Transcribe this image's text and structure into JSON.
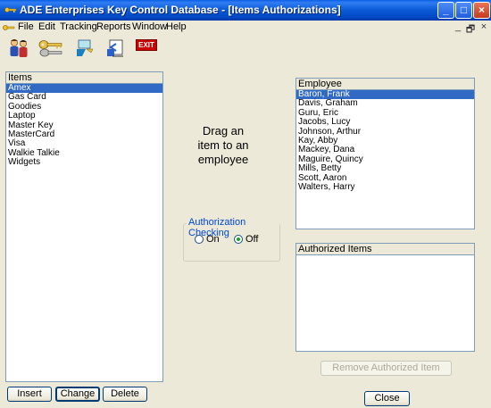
{
  "window": {
    "title": "ADE Enterprises Key Control Database - [Items Authorizations]",
    "buttons": {
      "minimize": "_",
      "maximize": "□",
      "close": "×"
    }
  },
  "menu": {
    "items": [
      "File",
      "Edit",
      "Tracking",
      "Reports",
      "Window",
      "Help"
    ],
    "mdi_controls": {
      "minimize": "_",
      "restore": "🗗",
      "close": "×"
    }
  },
  "toolbar": {
    "icons": [
      "people-icon",
      "keys-icon",
      "tracking-icon",
      "report-icon",
      "exit-icon"
    ],
    "exit_label": "EXIT"
  },
  "items_panel": {
    "header": "Items",
    "items": [
      "Amex",
      "Gas Card",
      "Goodies",
      "Laptop",
      "Master Key",
      "MasterCard",
      "Visa",
      "Walkie Talkie",
      "Widgets"
    ],
    "selected_index": 0
  },
  "instruction": {
    "line1": "Drag an",
    "line2": "item to an",
    "line3": "employee"
  },
  "authorization_checking": {
    "label": "Authorization Checking",
    "options": [
      "On",
      "Off"
    ],
    "selected": "Off"
  },
  "employee_panel": {
    "header": "Employee",
    "items": [
      "Baron, Frank",
      "Davis, Graham",
      "Guru, Eric",
      "Jacobs, Lucy",
      "Johnson, Arthur",
      "Kay, Abby",
      "Mackey, Dana",
      "Maguire, Quincy",
      "Mills, Betty",
      "Scott, Aaron",
      "Walters, Harry"
    ],
    "selected_index": 0
  },
  "authorized_panel": {
    "header": "Authorized Items"
  },
  "buttons": {
    "insert": "Insert",
    "change": "Change",
    "delete": "Delete",
    "remove_authorized": "Remove Authorized Item",
    "close": "Close"
  },
  "colors": {
    "titlebar": "#0a5fe6",
    "selection": "#316ac5",
    "window_bg": "#ece9d8",
    "groupbox_label": "#0046d5"
  }
}
